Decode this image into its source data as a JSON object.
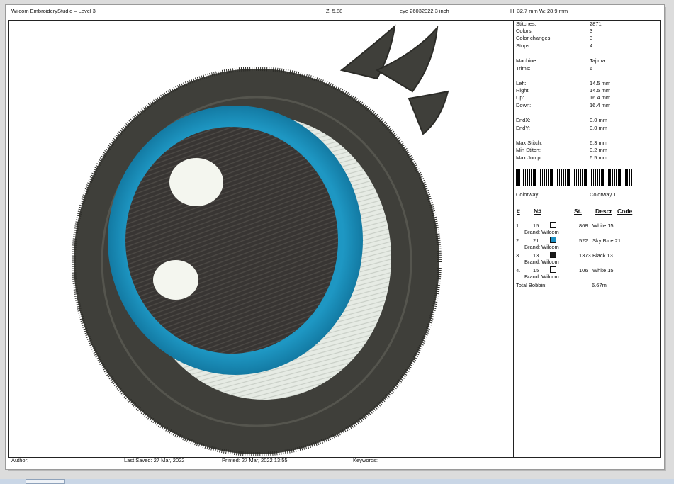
{
  "header": {
    "app_title": "Wilcom EmbroideryStudio – Level 3",
    "zoom": "Z: 5.88",
    "design_name": "eye 26032022 3 inch",
    "dimensions": "H: 32.7 mm   W: 28.9 mm"
  },
  "stats": [
    {
      "label": "Stitches:",
      "value": "2871"
    },
    {
      "label": "Colors:",
      "value": "3"
    },
    {
      "label": "Color changes:",
      "value": "3"
    },
    {
      "label": "Stops:",
      "value": "4"
    },
    {
      "label": "Machine:",
      "value": "Tajima"
    },
    {
      "label": "Trims:",
      "value": "6"
    },
    {
      "label": "Left:",
      "value": "14.5 mm"
    },
    {
      "label": "Right:",
      "value": "14.5 mm"
    },
    {
      "label": "Up:",
      "value": "16.4 mm"
    },
    {
      "label": "Down:",
      "value": "16.4 mm"
    },
    {
      "label": "EndX:",
      "value": "0.0 mm"
    },
    {
      "label": "EndY:",
      "value": "0.0 mm"
    },
    {
      "label": "Max Stitch:",
      "value": "6.3 mm"
    },
    {
      "label": "Min Stitch:",
      "value": "0.2 mm"
    },
    {
      "label": "Max Jump:",
      "value": "6.5 mm"
    }
  ],
  "colorway": {
    "label": "Colorway:",
    "value": "Colorway 1"
  },
  "thread_table": {
    "headers": {
      "index": "#",
      "number": "N#",
      "stitches": "St.",
      "descr": "Descr",
      "code": "Code"
    },
    "rows": [
      {
        "index": "1.",
        "number": "15",
        "color": "#ffffff",
        "stitches": "868",
        "descr": "White 15",
        "brand": "Brand: Wilcom"
      },
      {
        "index": "2.",
        "number": "21",
        "color": "#1a8fc4",
        "stitches": "522",
        "descr": "Sky Blue 21",
        "brand": "Brand: Wilcom"
      },
      {
        "index": "3.",
        "number": "13",
        "color": "#1a1a1a",
        "stitches": "1373",
        "descr": "Black 13",
        "brand": "Brand: Wilcom"
      },
      {
        "index": "4.",
        "number": "15",
        "color": "#ffffff",
        "stitches": "106",
        "descr": "White 15",
        "brand": "Brand: Wilcom"
      }
    ],
    "total_bobbin_label": "Total Bobbin:",
    "total_bobbin_value": "6.67m"
  },
  "footer": {
    "author": "Author:",
    "last_saved": "Last Saved: 27 Mar, 2022",
    "printed": "Printed: 27 Mar, 2022 13:55",
    "keywords": "Keywords:"
  },
  "colors": {
    "outline": "#3f3f3a",
    "iris": "#1e97c3",
    "pupil": "#383533",
    "sclera": "#e6ebe4",
    "highlight": "#f4f6ef"
  }
}
